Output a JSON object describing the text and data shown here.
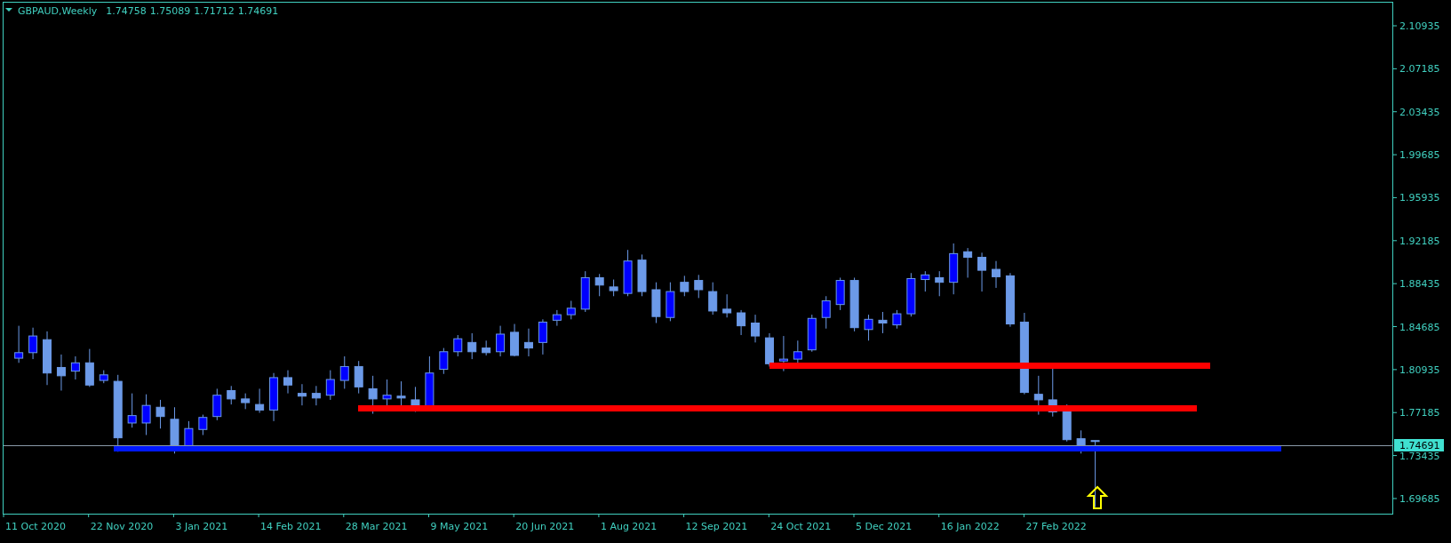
{
  "header": {
    "symbol": "GBPAUD,Weekly",
    "quotes": [
      "1.74758",
      "1.75089",
      "1.71712",
      "1.74691"
    ]
  },
  "price_axis": {
    "labels": [
      "2.10935",
      "2.07185",
      "2.03435",
      "1.99685",
      "1.95935",
      "1.92185",
      "1.88435",
      "1.84685",
      "1.80935",
      "1.77185",
      "1.73435",
      "1.69685"
    ],
    "current_price": "1.74691"
  },
  "date_axis": {
    "labels": [
      "11 Oct 2020",
      "22 Nov 2020",
      "3 Jan 2021",
      "14 Feb 2021",
      "28 Mar 2021",
      "9 May 2021",
      "20 Jun 2021",
      "1 Aug 2021",
      "12 Sep 2021",
      "24 Oct 2021",
      "5 Dec 2021",
      "16 Jan 2022",
      "27 Feb 2022"
    ]
  }
}
